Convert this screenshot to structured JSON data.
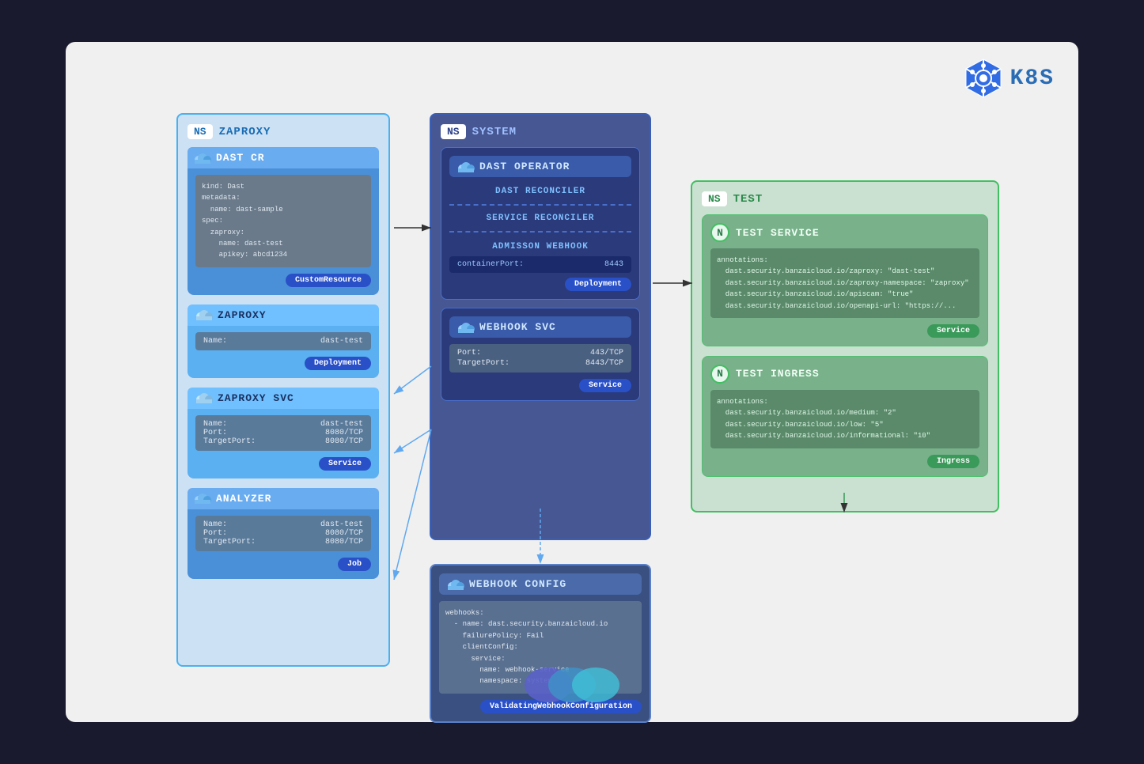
{
  "k8s": {
    "label": "K8S"
  },
  "ns_zaproxy": {
    "badge": "NS",
    "title": "ZAPROXY",
    "cards": {
      "dast_cr": {
        "title": "DAST CR",
        "body": "kind: Dast\nmetadata:\n  name: dast-sample\nspec:\n  zaproxy:\n    name: dast-test\n    apikey: abcd1234",
        "badge": "CustomResource"
      },
      "zaproxy": {
        "title": "ZAPROXY",
        "name_label": "Name:",
        "name_value": "dast-test",
        "badge": "Deployment"
      },
      "zaproxy_svc": {
        "title": "ZAPROXY SVC",
        "name_label": "Name:",
        "name_value": "dast-test",
        "port_label": "Port:",
        "port_value": "8080/TCP",
        "target_label": "TargetPort:",
        "target_value": "8080/TCP",
        "badge": "Service"
      },
      "analyzer": {
        "title": "ANALYZER",
        "name_label": "Name:",
        "name_value": "dast-test",
        "port_label": "Port:",
        "port_value": "8080/TCP",
        "target_label": "TargetPort:",
        "target_value": "8080/TCP",
        "badge": "Job"
      }
    }
  },
  "ns_system": {
    "badge": "NS",
    "title": "SYSTEM",
    "dast_operator": {
      "title": "DAST OPERATOR",
      "reconciler1": "DAST RECONCILER",
      "reconciler2": "SERVICE RECONCILER",
      "webhook_title": "ADMISSON WEBHOOK",
      "container_port_label": "containerPort:",
      "container_port_value": "8443",
      "badge": "Deployment"
    },
    "webhook_svc": {
      "title": "WEBHOOK SVC",
      "port_label": "Port:",
      "port_value": "443/TCP",
      "target_label": "TargetPort:",
      "target_value": "8443/TCP",
      "badge": "Service"
    }
  },
  "webhook_config": {
    "title": "WEBHOOK CONFIG",
    "body": "webhooks:\n  - name: dast.security.banzaicloud.io\n    failurePolicy: Fail\n    clientConfig:\n      service:\n        name: webhook-service\n        namespace: system",
    "badge": "ValidatingWebhookConfiguration"
  },
  "ns_test": {
    "badge": "NS",
    "title": "TEST",
    "test_service": {
      "n_badge": "N",
      "title": "TEST SERVICE",
      "body": "annotations:\n  dast.security.banzaicloud.io/zaproxy: \"dast-test\"\n  dast.security.banzaicloud.io/zaproxy-namespace: \"zaproxy\"\n  dast.security.banzaicloud.io/apiscam: \"true\"\n  dast.security.banzaicloud.io/openapi-url: \"https://...",
      "badge": "Service"
    },
    "test_ingress": {
      "n_badge": "N",
      "title": "TEST INGRESS",
      "body": "annotations:\n  dast.security.banzaicloud.io/medium: \"2\"\n  dast.security.banzaicloud.io/low: \"5\"\n  dast.security.banzaicloud.io/informational: \"10\"",
      "badge": "Ingress"
    }
  }
}
